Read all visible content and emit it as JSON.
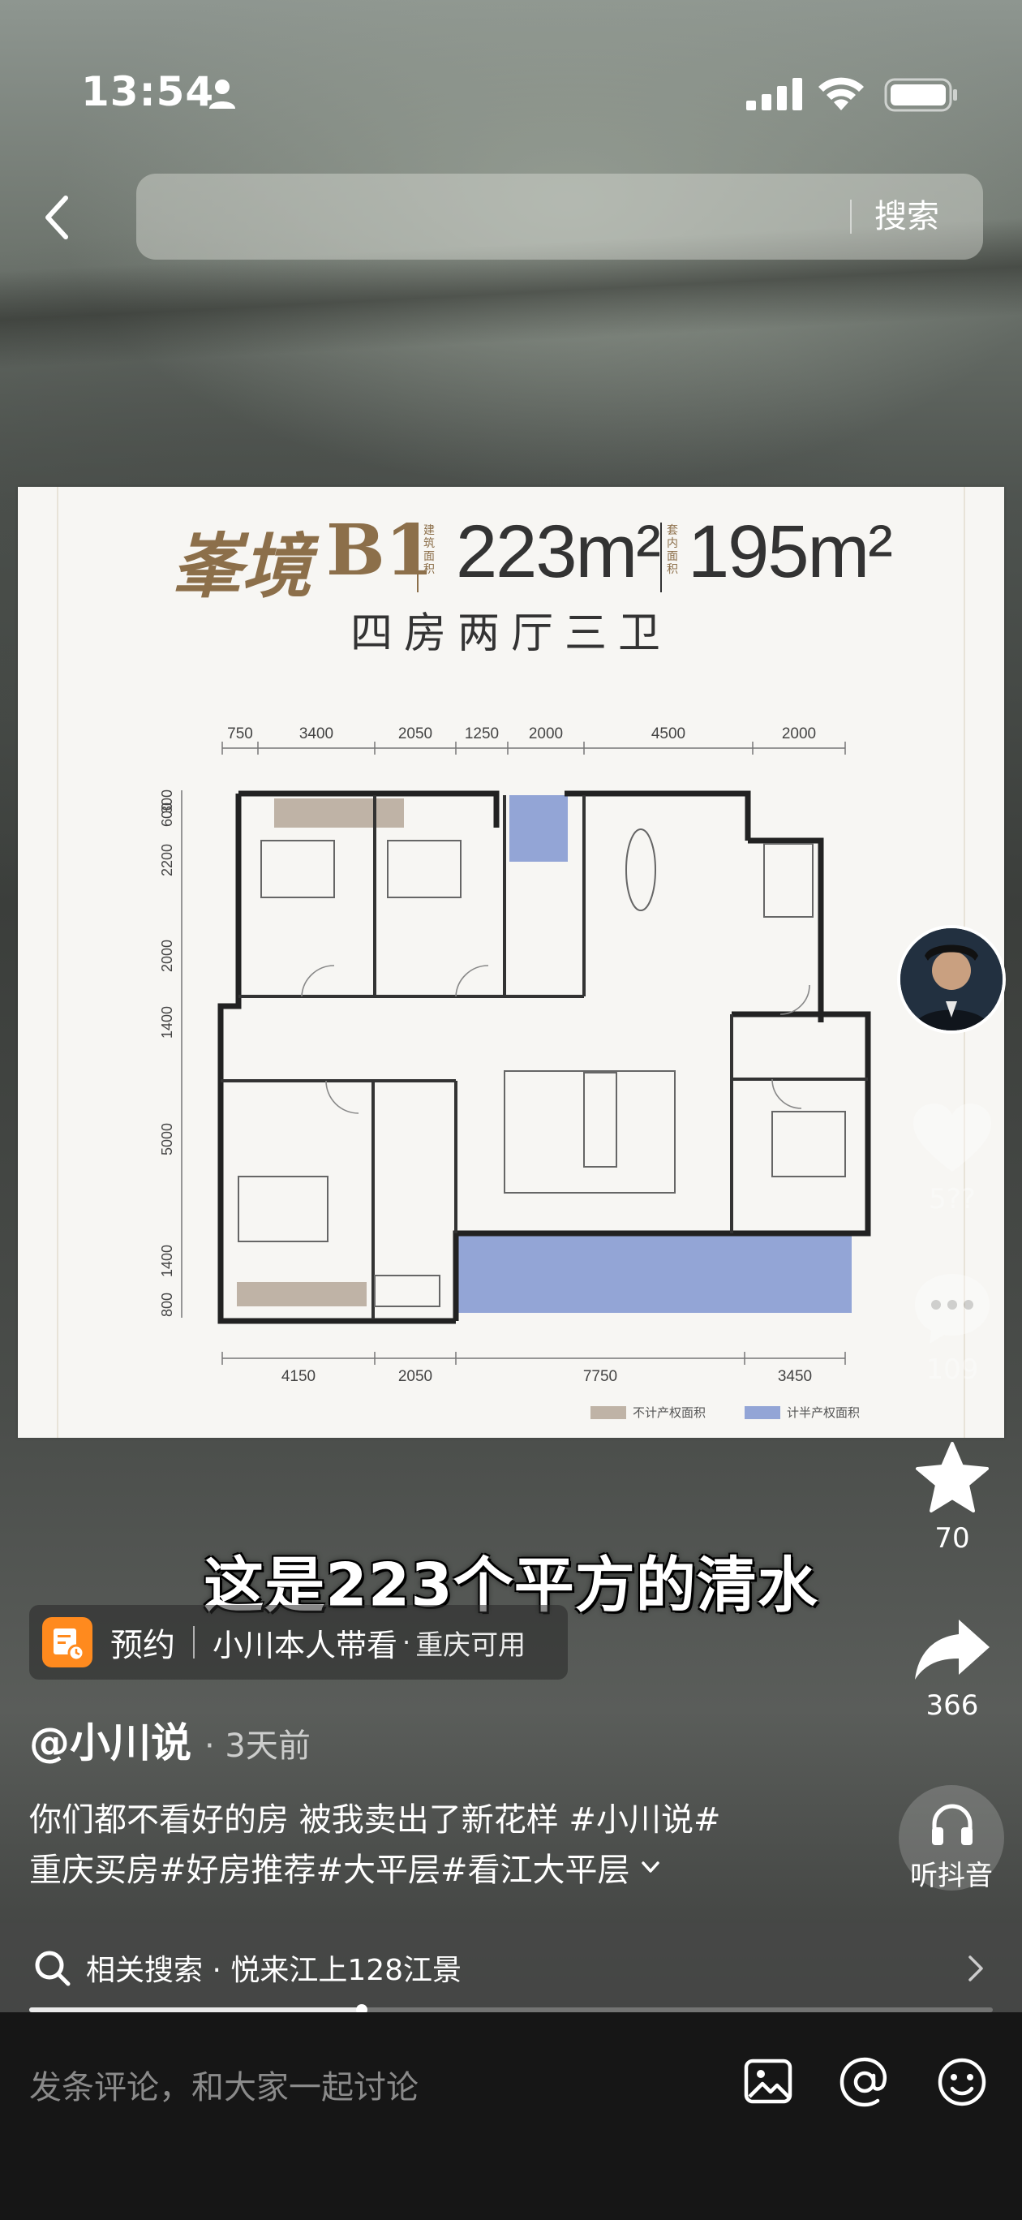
{
  "status_bar": {
    "time": "13:54"
  },
  "search": {
    "button_label": "搜索",
    "placeholder": ""
  },
  "floorplan": {
    "brand": "峯境",
    "model": "B1",
    "note_left": "建筑面积",
    "area_building": "223m²",
    "note_right": "套内面积",
    "area_inner": "195m²",
    "subtitle": "四房两厅三卫",
    "dims_top": [
      "750",
      "3400",
      "2050",
      "1250",
      "2000",
      "4500",
      "2000"
    ],
    "dims_bottom": [
      "4150",
      "2050",
      "7750",
      "3450"
    ],
    "dims_left": [
      "300",
      "600",
      "2200",
      "2000",
      "1400",
      "5000",
      "1400",
      "800"
    ],
    "legend_unrated": "不计产权面积",
    "legend_rated": "计半产权面积",
    "legend_colors": {
      "unrated": "#bfb3a6",
      "rated": "#93a5d6"
    }
  },
  "rail": {
    "like_count": "5??",
    "comment_count": "109",
    "favorite_count": "70",
    "share_count": "366",
    "listen_label": "听抖音"
  },
  "caption": "这是223个平方的清水",
  "booking": {
    "label": "预约",
    "host": "小川本人带看",
    "dot": "·",
    "city": "重庆可用"
  },
  "author": {
    "name": "@小川说",
    "time": "· 3天前"
  },
  "description": {
    "line1": "你们都不看好的房 被我卖出了新花样 #小川说#",
    "line2": "重庆买房#好房推荐#大平层#看江大平层"
  },
  "related": {
    "label": "相关搜索 · 悦来江上128江景"
  },
  "progress": {
    "fraction": 0.345
  },
  "comment_bar": {
    "placeholder": "发条评论，和大家一起讨论"
  },
  "icons": {
    "back": "chevron-left-icon",
    "person": "person-icon",
    "signal": "signal-icon",
    "wifi": "wifi-icon",
    "battery": "battery-icon",
    "heart": "heart-icon",
    "comment": "comment-icon",
    "star": "star-icon",
    "share": "share-icon",
    "headphones": "headphones-icon",
    "search": "search-icon",
    "image": "image-icon",
    "at": "at-icon",
    "emoji": "emoji-icon"
  }
}
